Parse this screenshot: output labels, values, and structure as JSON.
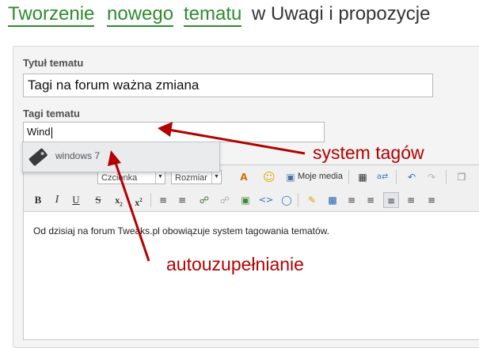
{
  "title": {
    "word1": "Tworzenie",
    "word2": "nowego",
    "word3": "tematu",
    "rest": "w Uwagi i propozycje"
  },
  "form": {
    "title_label": "Tytuł tematu",
    "title_value": "Tagi na forum ważna zmiana",
    "tags_label": "Tagi tematu",
    "tags_value": "Wind"
  },
  "autocomplete": {
    "suggestion": "windows 7"
  },
  "toolbar": {
    "font_select": "Czcionka",
    "size_select": "Rozmiar",
    "media_label": "Moje media"
  },
  "editor": {
    "content": "Od dzisiaj na forum Tweaks.pl obowiązuje system tagowania tematów."
  },
  "annotations": {
    "tags_system": "system tagów",
    "autocomplete": "autouzupełnianie"
  },
  "colors": {
    "title_link": "#2e8b2e",
    "annotation": "#b30000"
  }
}
